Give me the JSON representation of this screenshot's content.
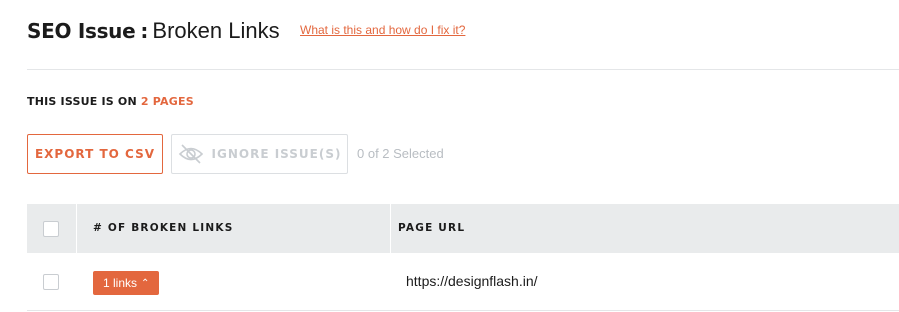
{
  "header": {
    "title_bold": "SEO Issue",
    "title_colon": ":",
    "title_light": "Broken Links",
    "help_link": "What is this and how do I fix it?"
  },
  "issue": {
    "label": "THIS ISSUE IS ON",
    "count": "2 PAGES"
  },
  "toolbar": {
    "export_label": "EXPORT TO CSV",
    "ignore_label": "IGNORE ISSUE(S)",
    "selected_text": "0 of 2 Selected"
  },
  "table": {
    "columns": [
      "# OF BROKEN LINKS",
      "PAGE URL"
    ],
    "rows": [
      {
        "links_label": "1 links",
        "url": "https://designflash.in/"
      }
    ]
  },
  "colors": {
    "accent": "#e3673e",
    "header_bg": "#e9ebec",
    "muted": "#c9cdd1"
  }
}
